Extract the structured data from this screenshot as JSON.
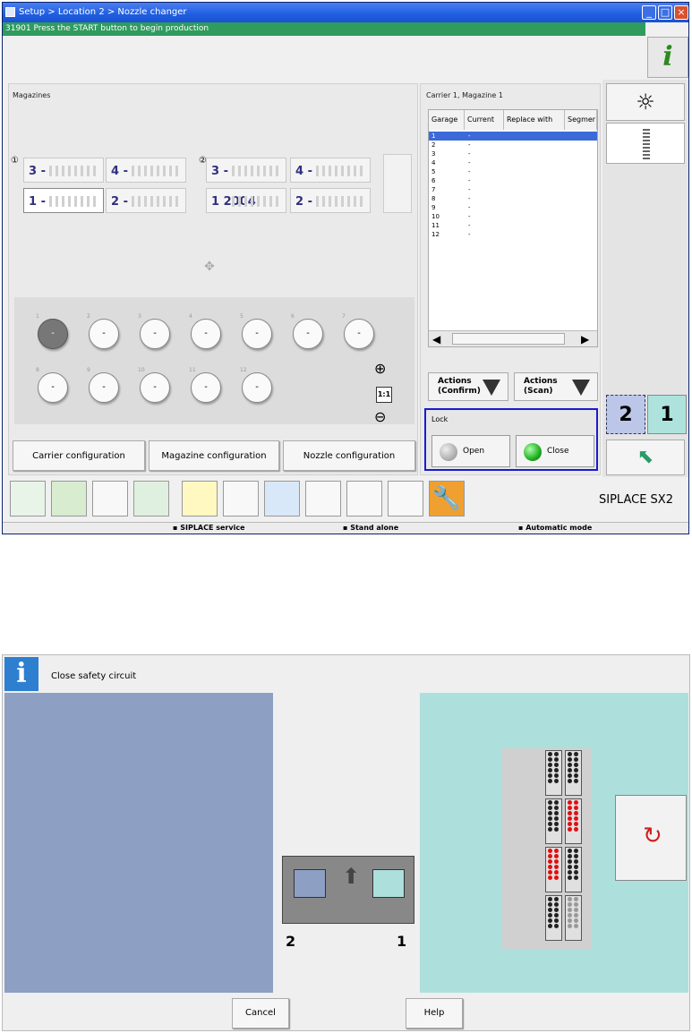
{
  "window": {
    "title": "Setup > Location 2 > Nozzle changer",
    "status": "31901 Press the START button to begin production",
    "info_glyph": "i"
  },
  "magazines": {
    "title": "Magazines",
    "group1_marker": "①",
    "group2_marker": "②",
    "boxes": [
      {
        "id": "3",
        "val": "-"
      },
      {
        "id": "4",
        "val": "-"
      },
      {
        "id": "1",
        "val": "-"
      },
      {
        "id": "2",
        "val": "-"
      },
      {
        "id": "3",
        "val": "-"
      },
      {
        "id": "4",
        "val": "-"
      },
      {
        "id": "1",
        "val": "2004"
      },
      {
        "id": "2",
        "val": "-"
      }
    ]
  },
  "nozzles": {
    "row1": [
      "1",
      "2",
      "3",
      "4",
      "5",
      "6",
      "7"
    ],
    "row2": [
      "8",
      "9",
      "10",
      "11",
      "12"
    ],
    "empty": "-",
    "zoom_label": "1:1"
  },
  "config": {
    "carrier": "Carrier configuration",
    "magazine": "Magazine configuration",
    "nozzle": "Nozzle configuration"
  },
  "carrier": {
    "title": "Carrier 1, Magazine 1",
    "headers": [
      "Garage",
      "Current",
      "Replace with",
      "Segmer"
    ],
    "rows": [
      [
        "1",
        "-"
      ],
      [
        "2",
        "-"
      ],
      [
        "3",
        "-"
      ],
      [
        "4",
        "-"
      ],
      [
        "5",
        "-"
      ],
      [
        "6",
        "-"
      ],
      [
        "7",
        "-"
      ],
      [
        "8",
        "-"
      ],
      [
        "9",
        "-"
      ],
      [
        "10",
        "-"
      ],
      [
        "11",
        "-"
      ],
      [
        "12",
        "-"
      ]
    ]
  },
  "actions": {
    "confirm": "Actions\n(Confirm)",
    "scan": "Actions\n(Scan)",
    "confirm_l1": "Actions",
    "confirm_l2": "(Confirm)",
    "scan_l1": "Actions",
    "scan_l2": "(Scan)"
  },
  "lock": {
    "title": "Lock",
    "open": "Open",
    "close": "Close"
  },
  "location": {
    "two": "2",
    "one": "1"
  },
  "brand": "SIPLACE SX2",
  "statusbar": {
    "service": "SIPLACE service",
    "stand": "Stand alone",
    "mode": "Automatic mode"
  },
  "dialog": {
    "message": "Close safety circuit",
    "info_glyph": "i",
    "label2": "2",
    "label1": "1",
    "cancel": "Cancel",
    "help": "Help"
  },
  "colors": {
    "title": "#1f5ee0",
    "status": "#2f9b5f",
    "led_green": "#1fb01f",
    "lock_border": "#1b1bd0",
    "accent_orange": "#f0a030"
  }
}
